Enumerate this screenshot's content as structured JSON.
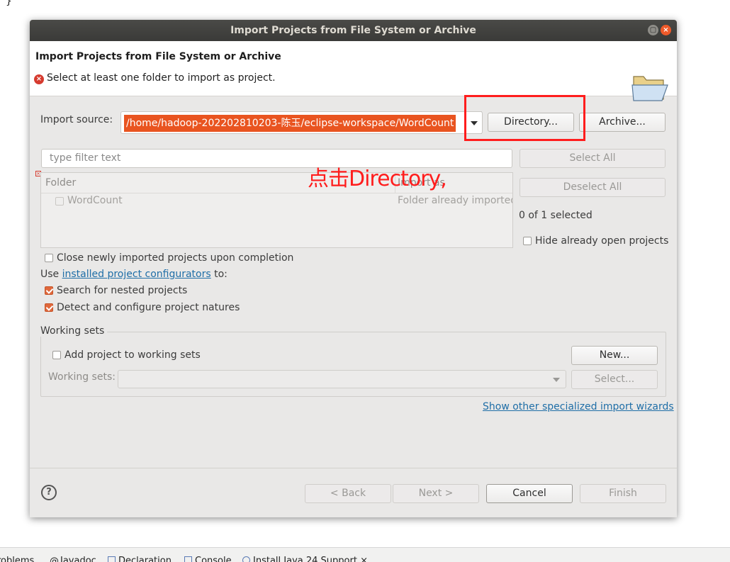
{
  "background": {
    "brace": "}",
    "bottom_tabs": [
      "roblems",
      "Javadoc",
      "Declaration",
      "Console",
      "Install Java 24 Support"
    ]
  },
  "dialog": {
    "window_title": "Import Projects from File System or Archive",
    "header_title": "Import Projects from File System or Archive",
    "error_message": "Select at least one folder to import as project.",
    "import_source_label": "Import source:",
    "import_source_value": "/home/hadoop-202202810203-陈玉/eclipse-workspace/WordCount",
    "directory_button": "Directory...",
    "archive_button": "Archive...",
    "filter_placeholder": "type filter text",
    "select_all_button": "Select All",
    "deselect_all_button": "Deselect All",
    "table": {
      "col_folder": "Folder",
      "col_import_as": "Import as",
      "rows": [
        {
          "folder": "WordCount",
          "import_as": "Folder already imported",
          "checked": false
        }
      ]
    },
    "selected_count": "0 of 1 selected",
    "hide_open_projects_label": "Hide already open projects",
    "close_newly_label": "Close newly imported projects upon completion",
    "use_prefix": "Use",
    "installed_configurators_link": "installed project configurators",
    "use_suffix": "to:",
    "search_nested_label": "Search for nested projects",
    "detect_configure_label": "Detect and configure project natures",
    "working_sets": {
      "title": "Working sets",
      "add_label": "Add project to working sets",
      "new_button": "New...",
      "sets_label": "Working sets:",
      "select_button": "Select..."
    },
    "show_other_wizards_link": "Show other specialized import wizards",
    "footer": {
      "help": "?",
      "back": "< Back",
      "next": "Next >",
      "cancel": "Cancel",
      "finish": "Finish"
    }
  },
  "annotation": {
    "text": "点击Directory,",
    "color": "#ff1d1d"
  },
  "colors": {
    "accent": "#e95420",
    "link": "#1f6ea7",
    "titlebar": "#3c3b37"
  }
}
